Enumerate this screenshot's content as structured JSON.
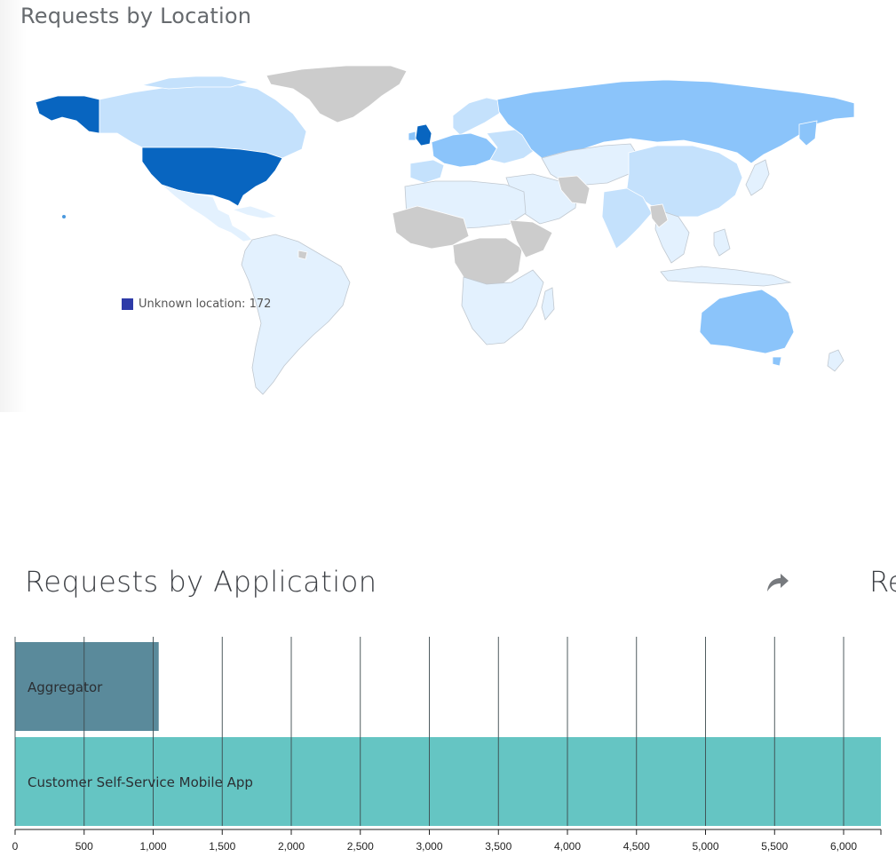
{
  "map": {
    "title": "Requests by Location",
    "legend": {
      "label": "Unknown location: 172",
      "color": "#2e3ba8"
    },
    "palette": {
      "none": "#cccccc",
      "level1": "#e3f1fe",
      "level2": "#c4e1fc",
      "level3": "#8bc4fa",
      "level4": "#4a98de",
      "level5": "#0865c0"
    }
  },
  "app_chart": {
    "title": "Requests by Application",
    "share_icon": "share-arrow-icon",
    "next_panel_title_fragment": "Re"
  },
  "chart_data": {
    "type": "bar",
    "orientation": "horizontal",
    "title": "Requests by Application",
    "categories": [
      "Aggregator",
      "Customer Self-Service Mobile App"
    ],
    "values": [
      1040,
      6270
    ],
    "colors": [
      "#5a8a9b",
      "#65c5c3"
    ],
    "xlim": [
      0,
      6270
    ],
    "xticks": [
      0,
      500,
      1000,
      1500,
      2000,
      2500,
      3000,
      3500,
      4000,
      4500,
      5000,
      5500,
      6000
    ],
    "xtick_labels": [
      "0",
      "500",
      "1,000",
      "1,500",
      "2,000",
      "2,500",
      "3,000",
      "3,500",
      "4,000",
      "4,500",
      "5,000",
      "5,500",
      "6,000"
    ],
    "grid": true
  }
}
